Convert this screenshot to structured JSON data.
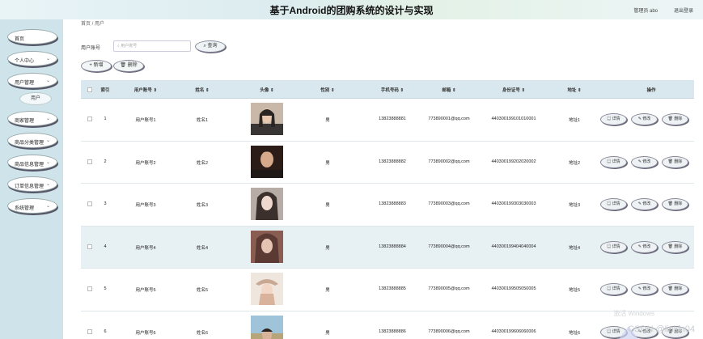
{
  "header": {
    "title": "基于Android的团购系统的设计与实现",
    "user": "管理员 abo",
    "logout": "退出登录"
  },
  "sidebar": {
    "items": [
      {
        "label": "首页",
        "chevron": ""
      },
      {
        "label": "个人中心",
        "chevron": "⌄"
      },
      {
        "label": "用户管理",
        "chevron": "⌄"
      },
      {
        "label": "商家管理",
        "chevron": "⌄"
      },
      {
        "label": "商品分类管理",
        "chevron": "⌄"
      },
      {
        "label": "商品信息管理",
        "chevron": "⌄"
      },
      {
        "label": "订单信息管理",
        "chevron": "⌄"
      },
      {
        "label": "系统管理",
        "chevron": "⌄"
      }
    ],
    "sub_item": "用户"
  },
  "breadcrumb": "首页 / 用户",
  "search": {
    "label": "用户账号",
    "placeholder": "⌕ 用户账号",
    "query_label": "⌕ 查询"
  },
  "toolbar": {
    "add_label": "+ 新增",
    "delete_label": "🗑 删除"
  },
  "table": {
    "columns": [
      "索引",
      "用户账号 ⇕",
      "姓名 ⇕",
      "头像 ⇕",
      "性别 ⇕",
      "手机号码 ⇕",
      "邮箱 ⇕",
      "身份证号 ⇕",
      "地址 ⇕",
      "操作"
    ],
    "rows": [
      {
        "idx": "1",
        "account": "用户账号1",
        "name": "姓名1",
        "gender": "男",
        "phone": "13823888881",
        "email": "773890001@qq.com",
        "id_card": "440300199101010001",
        "address": "地址1"
      },
      {
        "idx": "2",
        "account": "用户账号2",
        "name": "姓名2",
        "gender": "男",
        "phone": "13823888882",
        "email": "773890002@qq.com",
        "id_card": "440300199202020002",
        "address": "地址2"
      },
      {
        "idx": "3",
        "account": "用户账号3",
        "name": "姓名3",
        "gender": "男",
        "phone": "13823888883",
        "email": "773890003@qq.com",
        "id_card": "440300199303030003",
        "address": "地址3"
      },
      {
        "idx": "4",
        "account": "用户账号4",
        "name": "姓名4",
        "gender": "男",
        "phone": "13823888884",
        "email": "773890004@qq.com",
        "id_card": "440300199404040004",
        "address": "地址4"
      },
      {
        "idx": "5",
        "account": "用户账号5",
        "name": "姓名5",
        "gender": "男",
        "phone": "13823888885",
        "email": "773890005@qq.com",
        "id_card": "440300199505050005",
        "address": "地址5"
      },
      {
        "idx": "6",
        "account": "用户账号6",
        "name": "姓名6",
        "gender": "男",
        "phone": "13823888886",
        "email": "773890006@qq.com",
        "id_card": "440300199606060006",
        "address": "地址6"
      }
    ],
    "actions": {
      "detail": "▤ 详情",
      "edit": "✎ 修改",
      "delete": "🗑 删除"
    }
  },
  "watermark": {
    "main": "CSDN @linkin04",
    "faint": "激活 Windows"
  },
  "colors": {
    "sidebar_bg": "#cfe3ea",
    "header_row_bg": "#d9e8ee",
    "highlight_row": "#e7f0f3"
  }
}
